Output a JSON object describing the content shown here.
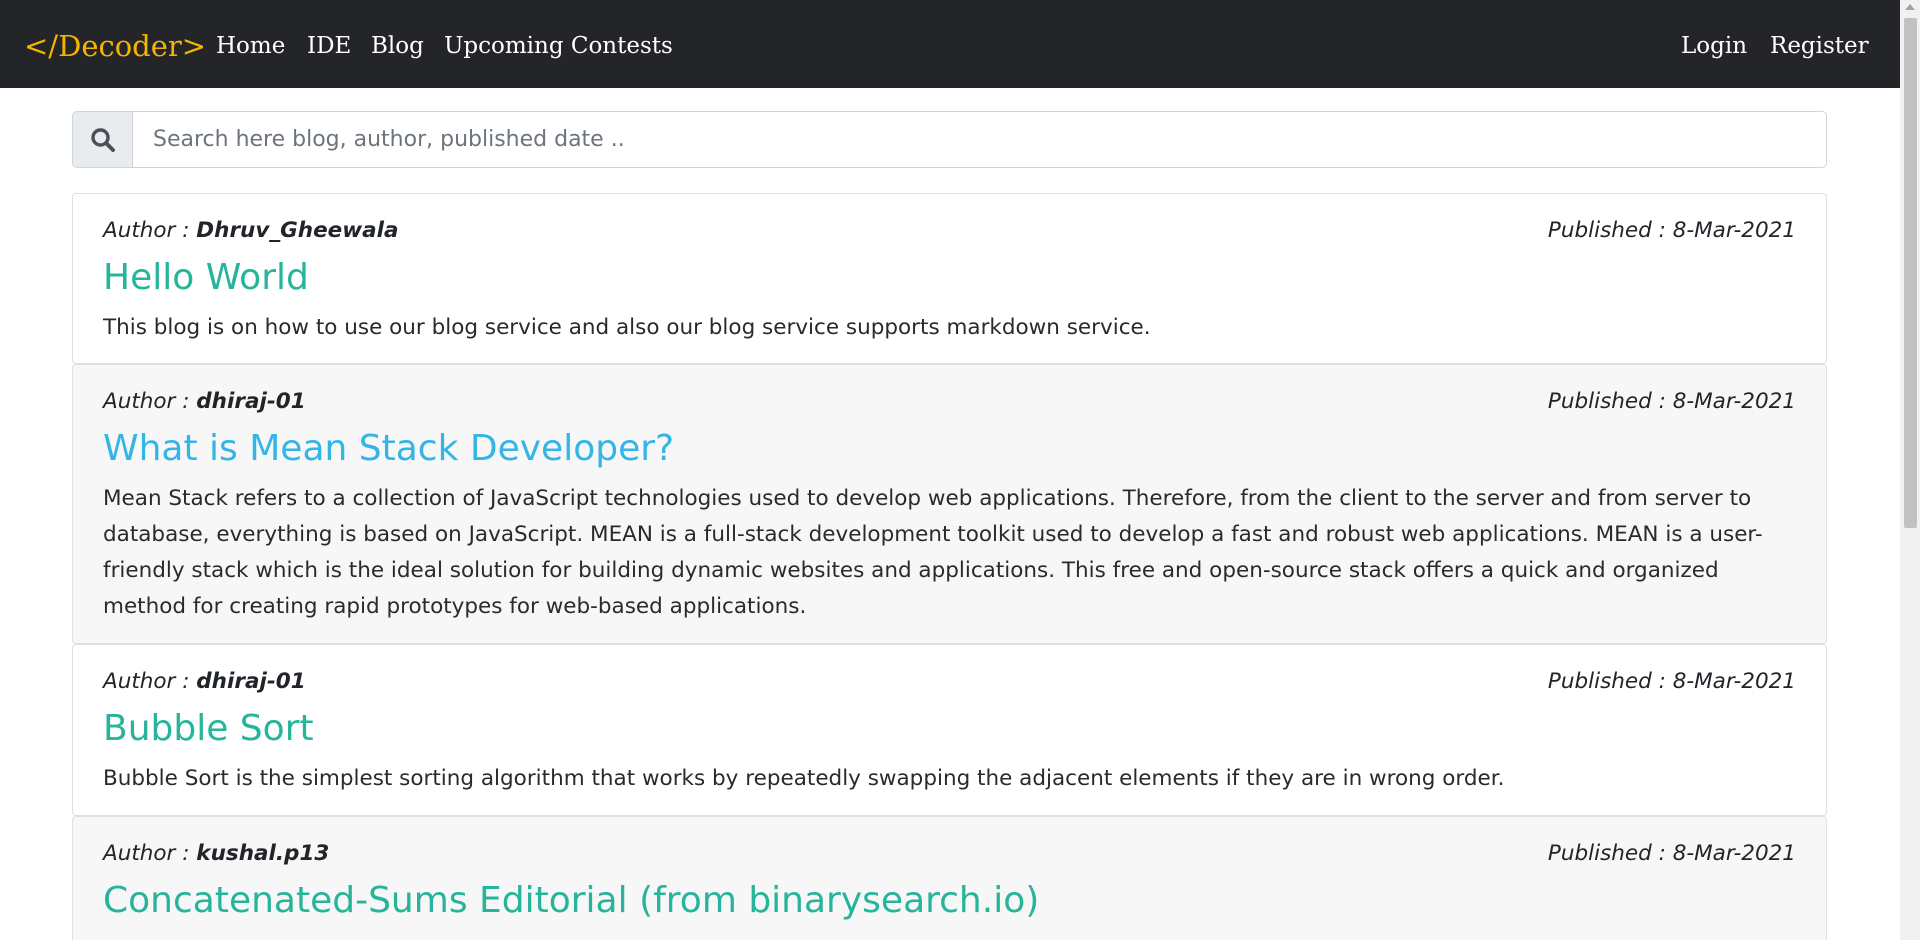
{
  "navbar": {
    "brand": "</Decoder>",
    "links": [
      "Home",
      "IDE",
      "Blog",
      "Upcoming Contests"
    ],
    "login": "Login",
    "register": "Register"
  },
  "search": {
    "placeholder": "Search here blog, author, published date ..",
    "icon": "search-icon"
  },
  "posts": [
    {
      "author_label": "Author : ",
      "author": "Dhruv_Gheewala",
      "published": "Published : 8-Mar-2021",
      "title": "Hello World",
      "description": "This blog is on how to use our blog service and also our blog service supports markdown service."
    },
    {
      "author_label": "Author : ",
      "author": "dhiraj-01",
      "published": "Published : 8-Mar-2021",
      "title": "What is Mean Stack Developer?",
      "description": "Mean Stack refers to a collection of JavaScript technologies used to develop web applications. Therefore, from the client to the server and from server to database, everything is based on JavaScript. MEAN is a full-stack development toolkit used to develop a fast and robust web applications. MEAN is a user-friendly stack which is the ideal solution for building dynamic websites and applications. This free and open-source stack offers a quick and organized method for creating rapid prototypes for web-based applications."
    },
    {
      "author_label": "Author : ",
      "author": "dhiraj-01",
      "published": "Published : 8-Mar-2021",
      "title": "Bubble Sort",
      "description": "Bubble Sort is the simplest sorting algorithm that works by repeatedly swapping the adjacent elements if they are in wrong order."
    },
    {
      "author_label": "Author : ",
      "author": "kushal.p13",
      "published": "Published : 8-Mar-2021",
      "title": "Concatenated-Sums Editorial (from binarysearch.io)",
      "description": ""
    }
  ],
  "colors": {
    "navbar_bg": "#242528",
    "brand": "#f5b400",
    "title_green": "#26b59a",
    "title_blue": "#33b5e5"
  }
}
